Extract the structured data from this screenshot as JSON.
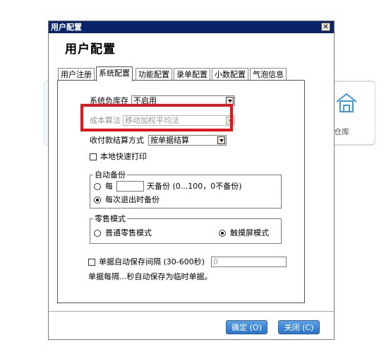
{
  "window": {
    "title": "用户配置",
    "heading": "用户配置"
  },
  "tabs": [
    "用户注册",
    "系统配置",
    "功能配置",
    "录单配置",
    "小数配置",
    "气泡信息"
  ],
  "active_tab": "系统配置",
  "form": {
    "system_negative_stock": {
      "label": "系统负库存",
      "value": "不启用"
    },
    "cost_algorithm": {
      "label": "成本算法",
      "value": "移动加权平均法"
    },
    "payment_settlement": {
      "label": "收付款结算方式",
      "value": "按单据结算"
    },
    "local_quick_print": {
      "label": "本地快速打印"
    },
    "auto_backup": {
      "title": "自动备份",
      "option_every": "每",
      "option_every_suffix": "天备份 (0...100，0不备份)",
      "option_exit": "每次退出时备份"
    },
    "retail_mode": {
      "title": "零售模式",
      "option_normal": "普通零售模式",
      "option_touch": "触摸屏模式"
    },
    "auto_save": {
      "label": "单据自动保存间隔 (30-600秒)",
      "value": "0"
    },
    "auto_save_note": "单据每隔...秒自动保存为临时单据。"
  },
  "buttons": {
    "ok": "确定 (O)",
    "close": "关闭 (C)"
  },
  "background": {
    "warehouse_label": "仓库"
  },
  "colors": {
    "highlight": "#e5141c",
    "titlebar": "#0a246a",
    "button": "#2c73c7"
  }
}
